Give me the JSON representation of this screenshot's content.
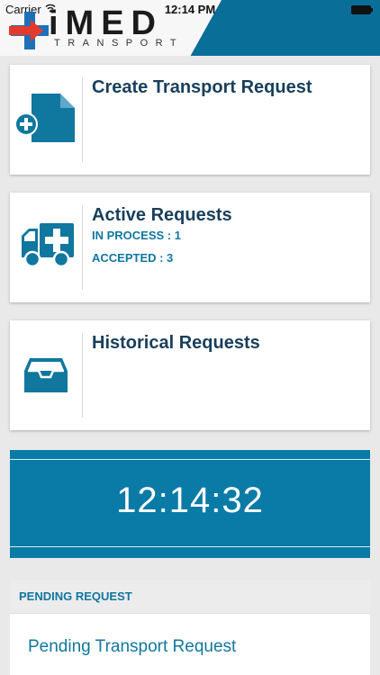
{
  "status_bar": {
    "carrier": "Carrier",
    "time": "12:14 PM",
    "wifi_icon": "wifi-icon",
    "battery_icon": "battery-icon"
  },
  "header": {
    "logo_text": "iMED",
    "logo_subtext": "TRANSPORT",
    "logo_icon": "medical-cross-arrow-icon",
    "brand_color": "#0a6f98",
    "cross_color": "#1e6fb8",
    "arrow_color": "#e23b2e"
  },
  "cards": {
    "create": {
      "title": "Create Transport Request",
      "icon": "add-document-icon"
    },
    "active": {
      "title": "Active Requests",
      "in_process": "IN PROCESS : 1",
      "accepted": "ACCEPTED : 3",
      "icon": "ambulance-icon"
    },
    "historical": {
      "title": "Historical Requests",
      "icon": "inbox-tray-icon"
    }
  },
  "clock": {
    "time": "12:14:32",
    "color": "#0a7ba6"
  },
  "pending": {
    "header": "PENDING REQUEST",
    "items": [
      "Pending Transport Request"
    ]
  },
  "colors": {
    "accent": "#10779f",
    "title": "#183f5c",
    "background": "#e9e9e9"
  }
}
